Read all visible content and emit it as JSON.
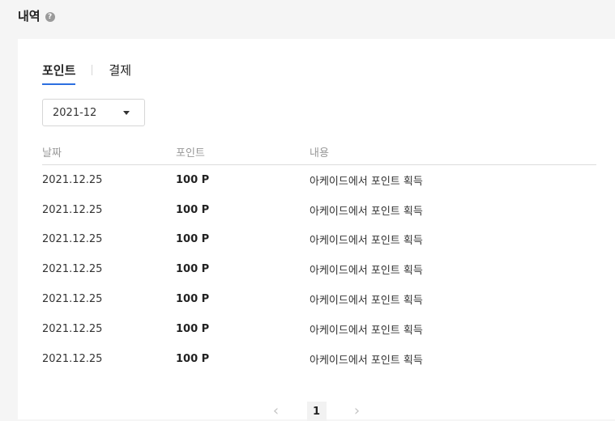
{
  "header": {
    "title": "내역",
    "help_icon": "?"
  },
  "tabs": [
    {
      "label": "포인트",
      "active": true
    },
    {
      "label": "결제",
      "active": false
    }
  ],
  "filter": {
    "month": "2021-12"
  },
  "table": {
    "headers": [
      "날짜",
      "포인트",
      "내용"
    ],
    "rows": [
      {
        "date": "2021.12.25",
        "point": "100 P",
        "desc": "아케이드에서 포인트 획득"
      },
      {
        "date": "2021.12.25",
        "point": "100 P",
        "desc": "아케이드에서 포인트 획득"
      },
      {
        "date": "2021.12.25",
        "point": "100 P",
        "desc": "아케이드에서 포인트 획득"
      },
      {
        "date": "2021.12.25",
        "point": "100 P",
        "desc": "아케이드에서 포인트 획득"
      },
      {
        "date": "2021.12.25",
        "point": "100 P",
        "desc": "아케이드에서 포인트 획득"
      },
      {
        "date": "2021.12.25",
        "point": "100 P",
        "desc": "아케이드에서 포인트 획득"
      },
      {
        "date": "2021.12.25",
        "point": "100 P",
        "desc": "아케이드에서 포인트 획득"
      }
    ]
  },
  "pagination": {
    "prev": "‹",
    "current": "1",
    "next": "›"
  },
  "colors": {
    "accent": "#2c6fe0",
    "header_text": "#999999",
    "border": "#dcdcdc"
  }
}
